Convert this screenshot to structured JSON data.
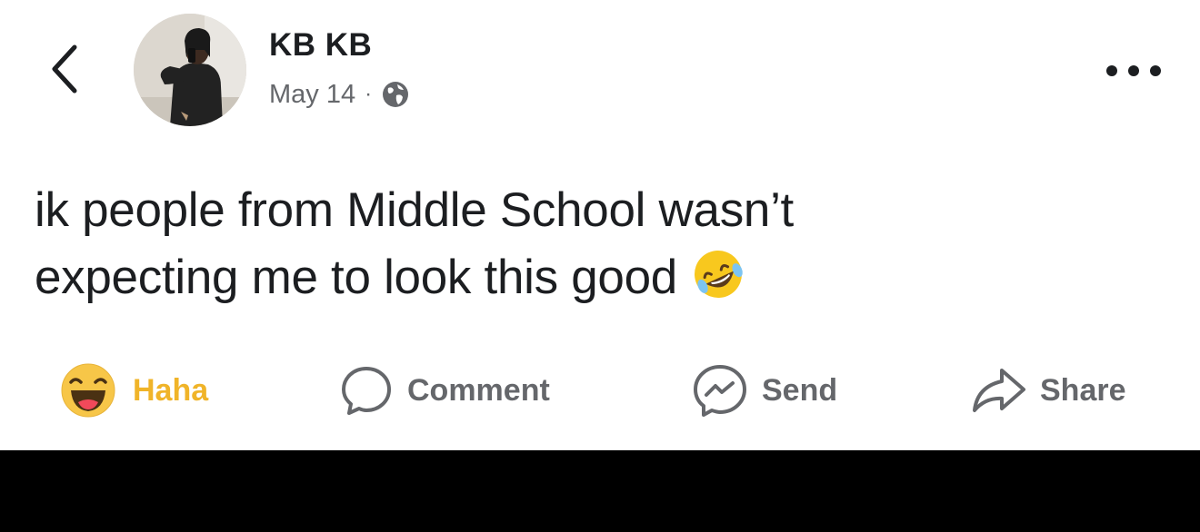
{
  "author": {
    "name": "KB KB",
    "date": "May 14",
    "separator": "·",
    "privacy_icon": "globe-icon",
    "avatar_icon": "profile-photo"
  },
  "header": {
    "back_icon": "chevron-left-icon",
    "more_icon": "more-dots-icon"
  },
  "post": {
    "line1": "ik people from Middle School wasn’t",
    "line2": "expecting me to look this good",
    "emoji": "rolling-on-floor-laughing-emoji"
  },
  "actions": [
    {
      "label": "Haha",
      "icon": "haha-reaction-icon",
      "active": true
    },
    {
      "label": "Comment",
      "icon": "comment-icon"
    },
    {
      "label": "Send",
      "icon": "messenger-icon"
    },
    {
      "label": "Share",
      "icon": "share-icon"
    }
  ],
  "colors": {
    "background": "#ffffff",
    "text": "#1c1e21",
    "secondary_text": "#65676b",
    "haha_active": "#f0b429",
    "bottom_bar": "#000000"
  }
}
